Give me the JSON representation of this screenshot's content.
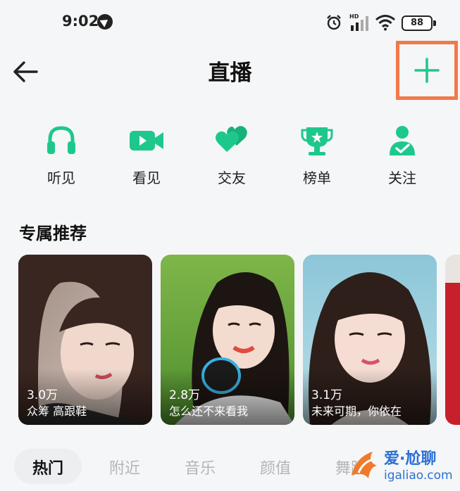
{
  "status_bar": {
    "time": "9:02",
    "battery": "88",
    "signal_label": "HD"
  },
  "header": {
    "title": "直播"
  },
  "quick_menu": [
    {
      "label": "听见",
      "icon": "headphones-icon"
    },
    {
      "label": "看见",
      "icon": "video-camera-icon"
    },
    {
      "label": "交友",
      "icon": "hearts-icon"
    },
    {
      "label": "榜单",
      "icon": "trophy-icon"
    },
    {
      "label": "关注",
      "icon": "user-check-icon"
    }
  ],
  "section": {
    "title": "专属推荐"
  },
  "cards": [
    {
      "count": "3.0万",
      "caption": "众筹 高跟鞋"
    },
    {
      "count": "2.8万",
      "caption": "怎么还不来看我"
    },
    {
      "count": "3.1万",
      "caption": "未来可期，你依在"
    }
  ],
  "tabs": [
    {
      "label": "热门",
      "active": true
    },
    {
      "label": "附近",
      "active": false
    },
    {
      "label": "音乐",
      "active": false
    },
    {
      "label": "颜值",
      "active": false
    },
    {
      "label": "舞蹈",
      "active": false
    }
  ],
  "watermark": {
    "text_cn": "爱·尬聊",
    "text_en": "igaliao.com"
  },
  "colors": {
    "accent": "#1ec88c",
    "highlight_box": "#f07a4b"
  }
}
